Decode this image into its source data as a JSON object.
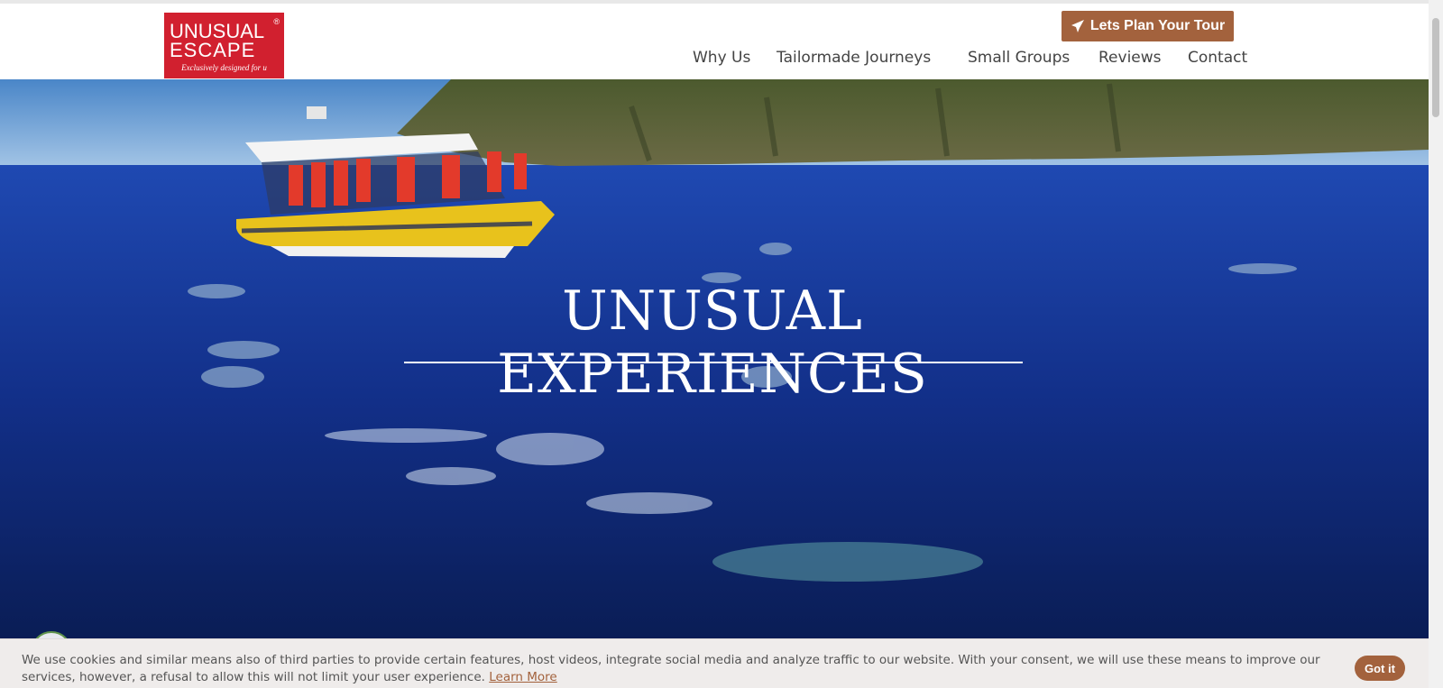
{
  "brand": {
    "line1": "UNUSUAL",
    "line2": "ESCAPE",
    "tagline": "Exclusively designed for u",
    "registered": "®"
  },
  "header": {
    "cta_label": "Lets Plan Your Tour",
    "cta_icon": "paper-plane-icon"
  },
  "nav": {
    "items": [
      {
        "label": "Why Us"
      },
      {
        "label": "Tailormade Journeys"
      },
      {
        "label": "Small Groups"
      },
      {
        "label": "Reviews"
      },
      {
        "label": "Contact"
      }
    ]
  },
  "hero": {
    "title": "UNUSUAL EXPERIENCES"
  },
  "cookie": {
    "text": "We use cookies and similar means also of third parties to provide certain features, host videos, integrate social media and analyze traffic to our website. With your consent, we will use these means to improve our services, however, a refusal to allow this will not limit your user experience. ",
    "learn_more": "Learn More",
    "button": "Got it"
  },
  "colors": {
    "accent": "#a3623d",
    "logo_red": "#d1202f",
    "ocean": "#13328a"
  }
}
